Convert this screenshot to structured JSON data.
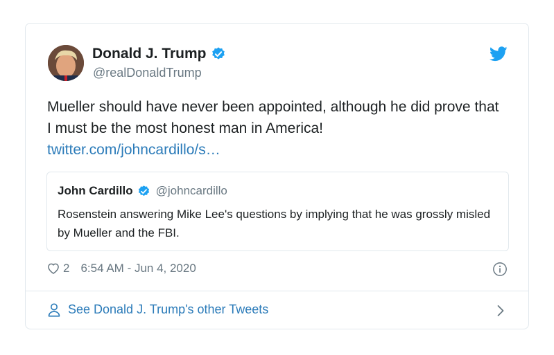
{
  "tweet": {
    "author": {
      "name": "Donald J. Trump",
      "handle": "@realDonaldTrump",
      "verified": true
    },
    "text": "Mueller should have never been appointed, although he did prove that I must be the most honest man in America!",
    "link": "twitter.com/johncardillo/s…",
    "quoted": {
      "name": "John Cardillo",
      "handle": "@johncardillo",
      "verified": true,
      "text": "Rosenstein answering Mike Lee's questions by implying that he was grossly misled by Mueller and the FBI."
    },
    "likes": "2",
    "timestamp": "6:54 AM - Jun 4, 2020"
  },
  "footer": {
    "label": "See Donald J. Trump's other Tweets"
  },
  "colors": {
    "verified_blue": "#1da1f2",
    "link_blue": "#2b7bb9",
    "muted_gray": "#697882",
    "border": "#e1e8ed"
  },
  "icons": {
    "brand": "twitter-bird-icon",
    "like": "heart-icon",
    "info": "info-icon",
    "profile": "person-icon",
    "more": "chevron-right-icon"
  }
}
